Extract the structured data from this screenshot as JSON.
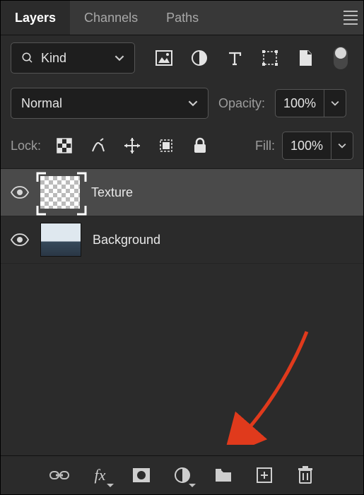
{
  "tabs": {
    "layers": "Layers",
    "channels": "Channels",
    "paths": "Paths"
  },
  "filter": {
    "kind": "Kind"
  },
  "blend": {
    "mode": "Normal"
  },
  "opacity": {
    "label": "Opacity:",
    "value": "100%"
  },
  "lock": {
    "label": "Lock:"
  },
  "fill": {
    "label": "Fill:",
    "value": "100%"
  },
  "layers_list": {
    "texture": "Texture",
    "background": "Background"
  }
}
